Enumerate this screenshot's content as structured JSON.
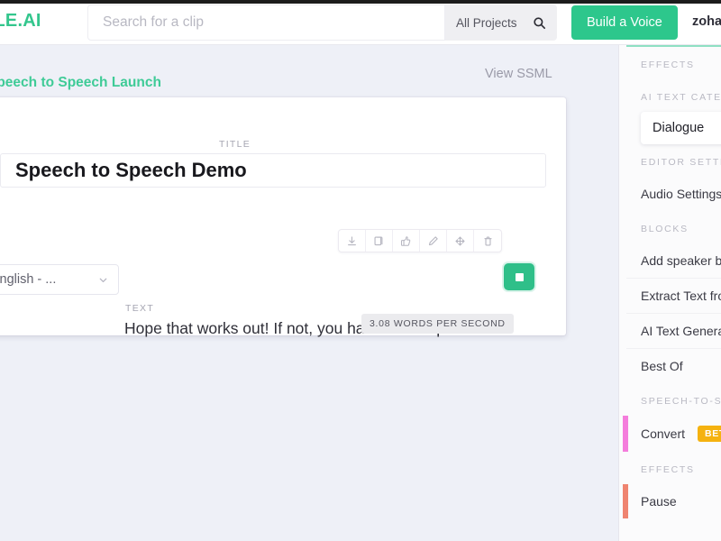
{
  "brand": {
    "logo_text": "MBLE.AI",
    "accent_green": "#2dc78c",
    "crumb_green": "#3fcb97"
  },
  "topbar": {
    "search_placeholder": "Search for a clip",
    "search_value": "",
    "projects_label": "All Projects",
    "search_icon": "search-icon",
    "build_voice_label": "Build a Voice",
    "user_name": "zoha"
  },
  "breadcrumb": {
    "label": "Speech to Speech Launch",
    "view_ssml_label": "View SSML"
  },
  "clip": {
    "title_label": "TITLE",
    "title_value": "Speech to Speech Demo",
    "text_label": "TEXT",
    "text_value": "Hope that works out! If not, you have a few options.",
    "voice_value": "(English - ...",
    "wps_badge": "3.08 WORDS PER SECOND",
    "stop_button_label": "stop",
    "toolbar": [
      {
        "name": "download-icon",
        "title": "Download"
      },
      {
        "name": "copy-icon",
        "title": "Copy"
      },
      {
        "name": "thumbs-up-icon",
        "title": "Like"
      },
      {
        "name": "pencil-icon",
        "title": "Edit"
      },
      {
        "name": "move-icon",
        "title": "Move"
      },
      {
        "name": "trash-icon",
        "title": "Delete"
      }
    ]
  },
  "sidebar": {
    "sections": [
      {
        "type": "section",
        "label": "EFFECTS"
      },
      {
        "type": "section",
        "label": "AI TEXT CATEG"
      },
      {
        "type": "chip",
        "label": "Dialogue"
      },
      {
        "type": "section",
        "label": "EDITOR SETTI"
      },
      {
        "type": "row",
        "label": "Audio Settings",
        "accent": "",
        "badge": ""
      },
      {
        "type": "section",
        "label": "BLOCKS"
      },
      {
        "type": "row",
        "label": "Add speaker bel",
        "accent": "",
        "badge": ""
      },
      {
        "type": "row",
        "label": "Extract Text from",
        "accent": "",
        "badge": ""
      },
      {
        "type": "row",
        "label": "AI Text Generatio",
        "accent": "",
        "badge": ""
      },
      {
        "type": "row",
        "label": "Best Of",
        "accent": "",
        "badge": ""
      },
      {
        "type": "section",
        "label": "SPEECH-TO-S"
      },
      {
        "type": "row",
        "label": "Convert",
        "accent": "#f47ddc",
        "badge": "BET",
        "badge_color": "#f5b210"
      },
      {
        "type": "section",
        "label": "EFFECTS"
      },
      {
        "type": "row",
        "label": "Pause",
        "accent": "#ef8470",
        "badge": ""
      }
    ]
  }
}
